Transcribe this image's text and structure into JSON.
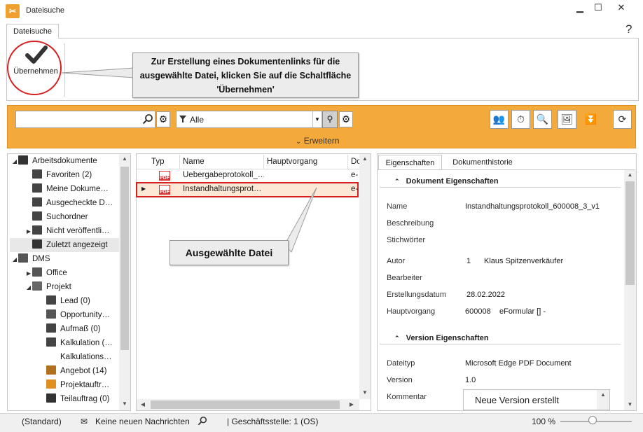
{
  "window": {
    "title": "Dateisuche",
    "minimize": "▁",
    "maximize": "☐",
    "close": "✕"
  },
  "ribbon": {
    "tab": "Dateisuche",
    "help": "?",
    "apply_label": "Übernehmen"
  },
  "callouts": {
    "apply": "Zur Erstellung eines Dokumentenlinks für die ausgewählte Datei, klicken Sie auf die Schaltfläche 'Übernehmen'",
    "file": "Ausgewählte Datei"
  },
  "search": {
    "value": "",
    "filter_value": "Alle",
    "expand_label": "Erweitern"
  },
  "tree": {
    "items": [
      {
        "label": "Arbeitsdokumente",
        "icon": "folder-dark-icon"
      },
      {
        "label": "Favoriten (2)",
        "icon": "star-folder-icon"
      },
      {
        "label": "Meine Dokume…",
        "icon": "user-folder-icon"
      },
      {
        "label": "Ausgecheckte D…",
        "icon": "lock-folder-icon"
      },
      {
        "label": "Suchordner",
        "icon": "search-folder-icon"
      },
      {
        "label": "Nicht veröffentli…",
        "icon": "folder-icon"
      },
      {
        "label": "Zuletzt angezeigt",
        "icon": "clock-icon"
      },
      {
        "label": "DMS",
        "icon": "dms-icon"
      },
      {
        "label": "Office",
        "icon": "gear-icon"
      },
      {
        "label": "Projekt",
        "icon": "project-icon"
      },
      {
        "label": "Lead (0)",
        "icon": "funnel-icon"
      },
      {
        "label": "Opportunity…",
        "icon": "opportunity-icon"
      },
      {
        "label": "Aufmaß (0)",
        "icon": "ruler-icon"
      },
      {
        "label": "Kalkulation (…",
        "icon": "calculator-icon"
      },
      {
        "label": "Kalkulations…",
        "icon": ""
      },
      {
        "label": "Angebot (14)",
        "icon": "tag-icon"
      },
      {
        "label": "Projektauftr…",
        "icon": "order-icon"
      },
      {
        "label": "Teilauftrag (0)",
        "icon": "partial-order-icon"
      }
    ]
  },
  "list": {
    "columns": [
      "Typ",
      "Name",
      "Hauptvorgang",
      "Do"
    ],
    "rows": [
      {
        "type": "PDF",
        "name": "Uebergabeprotokoll_…",
        "main": "",
        "doc": "e-"
      },
      {
        "type": "PDF",
        "name": "Instandhaltungsprot…",
        "main": "",
        "doc": "e-"
      }
    ]
  },
  "props": {
    "tabs": [
      "Eigenschaften",
      "Dokumenthistorie"
    ],
    "doc_section": "Dokument Eigenschaften",
    "version_section": "Version Eigenschaften",
    "labels": {
      "name": "Name",
      "description": "Beschreibung",
      "keywords": "Stichwörter",
      "author": "Autor",
      "editor": "Bearbeiter",
      "created": "Erstellungsdatum",
      "main": "Hauptvorgang",
      "filetype": "Dateityp",
      "version": "Version",
      "comment": "Kommentar"
    },
    "values": {
      "name": "Instandhaltungsprotokoll_600008_3_v1",
      "author_id": "1",
      "author_name": "Klaus Spitzenverkäufer",
      "created": "28.02.2022",
      "main_id": "600008",
      "main_desc": "eFormular [] -",
      "filetype": "Microsoft Edge PDF Document",
      "version": "1.0",
      "comment": "Neue Version erstellt"
    }
  },
  "status": {
    "profile": "(Standard)",
    "messages": "Keine neuen Nachrichten",
    "branch": "| Geschäftsstelle: 1 (OS)",
    "zoom": "100 %",
    "zoom_level": 0.45
  },
  "colors": {
    "accent_orange": "#f4a93b",
    "highlight_red": "#d42020",
    "pdf_red": "#d33333"
  }
}
